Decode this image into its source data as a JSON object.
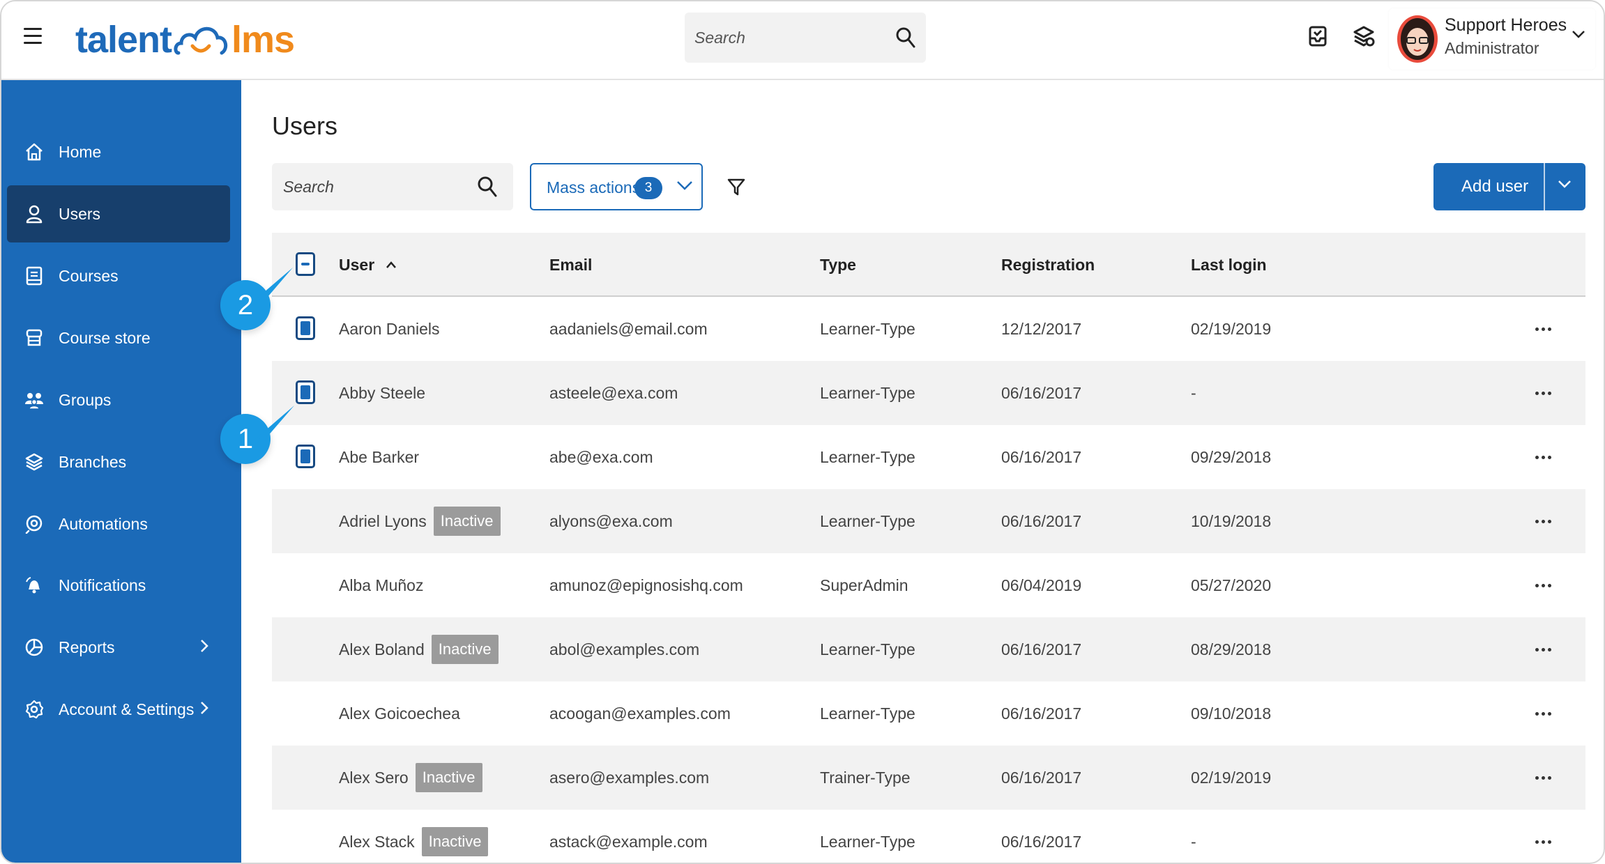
{
  "app": {
    "logo_text_left": "talent",
    "logo_text_right": "lms",
    "colors": {
      "primary": "#1b6ab8",
      "active_nav": "#173f6c",
      "logo_blue": "#1e6ab9",
      "logo_orange": "#f08a1c",
      "callout": "#1a9ae3",
      "inactive_badge": "#9b9b9b"
    }
  },
  "topbar": {
    "search_placeholder": "Search",
    "icons": [
      "menu-icon",
      "inbox-icon",
      "branches-switch-icon",
      "search-icon"
    ],
    "user": {
      "name": "Support Heroes",
      "role": "Administrator"
    }
  },
  "sidebar": {
    "items": [
      {
        "label": "Home",
        "icon": "home-icon",
        "active": false
      },
      {
        "label": "Users",
        "icon": "user-icon",
        "active": true
      },
      {
        "label": "Courses",
        "icon": "courses-icon",
        "active": false
      },
      {
        "label": "Course store",
        "icon": "course-store-icon",
        "active": false
      },
      {
        "label": "Groups",
        "icon": "groups-icon",
        "active": false
      },
      {
        "label": "Branches",
        "icon": "branches-icon",
        "active": false
      },
      {
        "label": "Automations",
        "icon": "automations-icon",
        "active": false
      },
      {
        "label": "Notifications",
        "icon": "notifications-icon",
        "active": false
      },
      {
        "label": "Reports",
        "icon": "reports-icon",
        "active": false,
        "has_submenu": true
      },
      {
        "label": "Account & Settings",
        "icon": "settings-icon",
        "active": false,
        "has_submenu": true
      }
    ]
  },
  "main": {
    "title": "Users",
    "search_placeholder": "Search",
    "mass_actions": {
      "label": "Mass actions",
      "count": "3"
    },
    "add_user_label": "Add user",
    "table": {
      "headers": {
        "user": "User",
        "email": "Email",
        "type": "Type",
        "registration": "Registration",
        "last_login": "Last login"
      },
      "sort": "user-ascending",
      "select_all_state": "partial",
      "rows": [
        {
          "name": "Aaron Daniels",
          "inactive": false,
          "email": "aadaniels@email.com",
          "type": "Learner-Type",
          "registration": "12/12/2017",
          "last_login": "02/19/2019",
          "checked": true
        },
        {
          "name": "Abby Steele",
          "inactive": false,
          "email": "asteele@exa.com",
          "type": "Learner-Type",
          "registration": "06/16/2017",
          "last_login": "-",
          "checked": true
        },
        {
          "name": "Abe Barker",
          "inactive": false,
          "email": "abe@exa.com",
          "type": "Learner-Type",
          "registration": "06/16/2017",
          "last_login": "09/29/2018",
          "checked": true
        },
        {
          "name": "Adriel Lyons",
          "inactive": true,
          "email": "alyons@exa.com",
          "type": "Learner-Type",
          "registration": "06/16/2017",
          "last_login": "10/19/2018",
          "checked": false
        },
        {
          "name": "Alba Muñoz",
          "inactive": false,
          "email": "amunoz@epignosishq.com",
          "type": "SuperAdmin",
          "registration": "06/04/2019",
          "last_login": "05/27/2020",
          "checked": false
        },
        {
          "name": "Alex Boland",
          "inactive": true,
          "email": "abol@examples.com",
          "type": "Learner-Type",
          "registration": "06/16/2017",
          "last_login": "08/29/2018",
          "checked": false
        },
        {
          "name": "Alex Goicoechea",
          "inactive": false,
          "email": "acoogan@examples.com",
          "type": "Learner-Type",
          "registration": "06/16/2017",
          "last_login": "09/10/2018",
          "checked": false
        },
        {
          "name": "Alex Sero",
          "inactive": true,
          "email": "asero@examples.com",
          "type": "Trainer-Type",
          "registration": "06/16/2017",
          "last_login": "02/19/2019",
          "checked": false
        },
        {
          "name": "Alex Stack",
          "inactive": true,
          "email": "astack@example.com",
          "type": "Learner-Type",
          "registration": "06/16/2017",
          "last_login": "-",
          "checked": false
        }
      ],
      "inactive_label": "Inactive"
    }
  },
  "callouts": [
    "2",
    "1"
  ]
}
